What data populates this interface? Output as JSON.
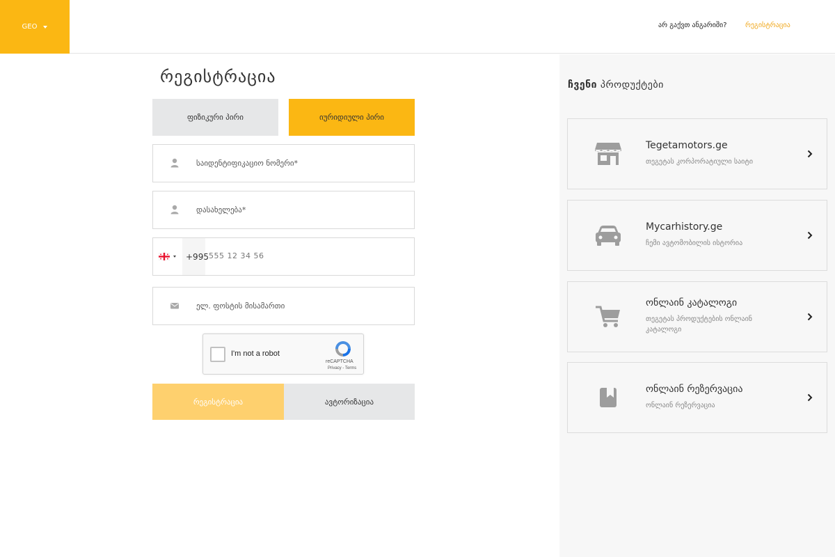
{
  "header": {
    "language": "GEO",
    "no_account_question": "არ გაქვთ ანგარიში?",
    "register_link": "რეგისტრაცია"
  },
  "form": {
    "title": "რეგისტრაცია",
    "tabs": [
      {
        "label": "ფიზიკური პირი",
        "active": false
      },
      {
        "label": "იურიდიული პირი",
        "active": true
      }
    ],
    "id_number_placeholder": "საიდენტიფიკაციო ნომერი*",
    "company_name_placeholder": "დასახელება*",
    "phone": {
      "country_flag": "georgia-flag-icon",
      "dial_code": "+995",
      "placeholder": "555 12 34 56"
    },
    "email_placeholder": "ელ. ფოსტის მისამართი",
    "captcha": {
      "label": "I'm not a robot",
      "brand": "reCAPTCHA",
      "links": "Privacy - Terms"
    },
    "register_button": "რეგისტრაცია",
    "auth_button": "ავტორიზაცია"
  },
  "sidebar": {
    "title_bold": "ჩვენი",
    "title_rest": "პროდუქტები",
    "products": [
      {
        "name": "Tegetamotors.ge",
        "subtitle": "თეგეტას კორპორატიული საიტი",
        "icon": "store-icon"
      },
      {
        "name": "Mycarhistory.ge",
        "subtitle": "ჩემი ავტომობილის ისტორია",
        "icon": "car-icon"
      },
      {
        "name": "ონლაინ კატალოგი",
        "subtitle": "თეგეტას პროდუქტების ონლაინ კატალოგი",
        "icon": "cart-icon"
      },
      {
        "name": "ონლაინ რეზერვაცია",
        "subtitle": "ონლაინ რეზერვაცია",
        "icon": "bookmark-icon"
      }
    ]
  },
  "colors": {
    "accent": "#fbb713",
    "accent_light": "#fed06e",
    "link": "#f0a71b",
    "tab_inactive": "#e6e7e8",
    "sidebar_bg": "#f7f7f7"
  }
}
